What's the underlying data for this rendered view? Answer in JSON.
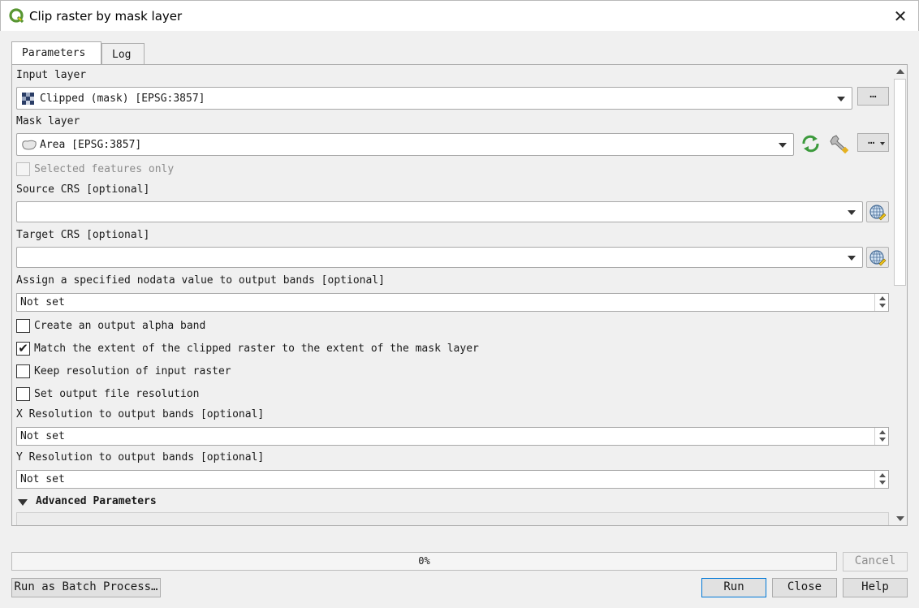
{
  "window": {
    "title": "Clip raster by mask layer"
  },
  "tabs": [
    {
      "label": "Parameters"
    },
    {
      "label": "Log"
    }
  ],
  "params": {
    "input_layer": {
      "label": "Input layer",
      "value": "Clipped (mask) [EPSG:3857]",
      "button": "…"
    },
    "mask_layer": {
      "label": "Mask layer",
      "value": "Area [EPSG:3857]",
      "button": "…"
    },
    "selected_only": {
      "label": "Selected features only",
      "checked": false
    },
    "source_crs": {
      "label": "Source CRS [optional]",
      "value": ""
    },
    "target_crs": {
      "label": "Target CRS [optional]",
      "value": ""
    },
    "nodata": {
      "label": "Assign a specified nodata value to output bands [optional]",
      "value": "Not set"
    },
    "alpha_band": {
      "label": "Create an output alpha band",
      "checked": false
    },
    "match_extent": {
      "label": "Match the extent of the clipped raster to the extent of the mask layer",
      "checked": true,
      "mark": "✔"
    },
    "keep_resolution": {
      "label": "Keep resolution of input raster",
      "checked": false
    },
    "set_resolution": {
      "label": "Set output file resolution",
      "checked": false
    },
    "x_res": {
      "label": "X Resolution to output bands [optional]",
      "value": "Not set"
    },
    "y_res": {
      "label": "Y Resolution to output bands [optional]",
      "value": "Not set"
    },
    "advanced": {
      "label": "Advanced Parameters"
    }
  },
  "progress": {
    "text": "0%",
    "value": 0
  },
  "buttons": {
    "cancel": "Cancel",
    "batch": "Run as Batch Process…",
    "run": "Run",
    "close": "Close",
    "help": "Help"
  },
  "icons": {
    "app": "qgis-logo-icon",
    "close": "close-icon",
    "raster": "raster-layer-icon",
    "polygon": "polygon-layer-icon",
    "iterate": "iterate-icon",
    "wrench": "wrench-icon",
    "crs": "crs-globe-icon"
  },
  "colors": {
    "accent": "#0078d7",
    "qgis_green": "#589632",
    "qgis_yellow": "#ee7913"
  }
}
